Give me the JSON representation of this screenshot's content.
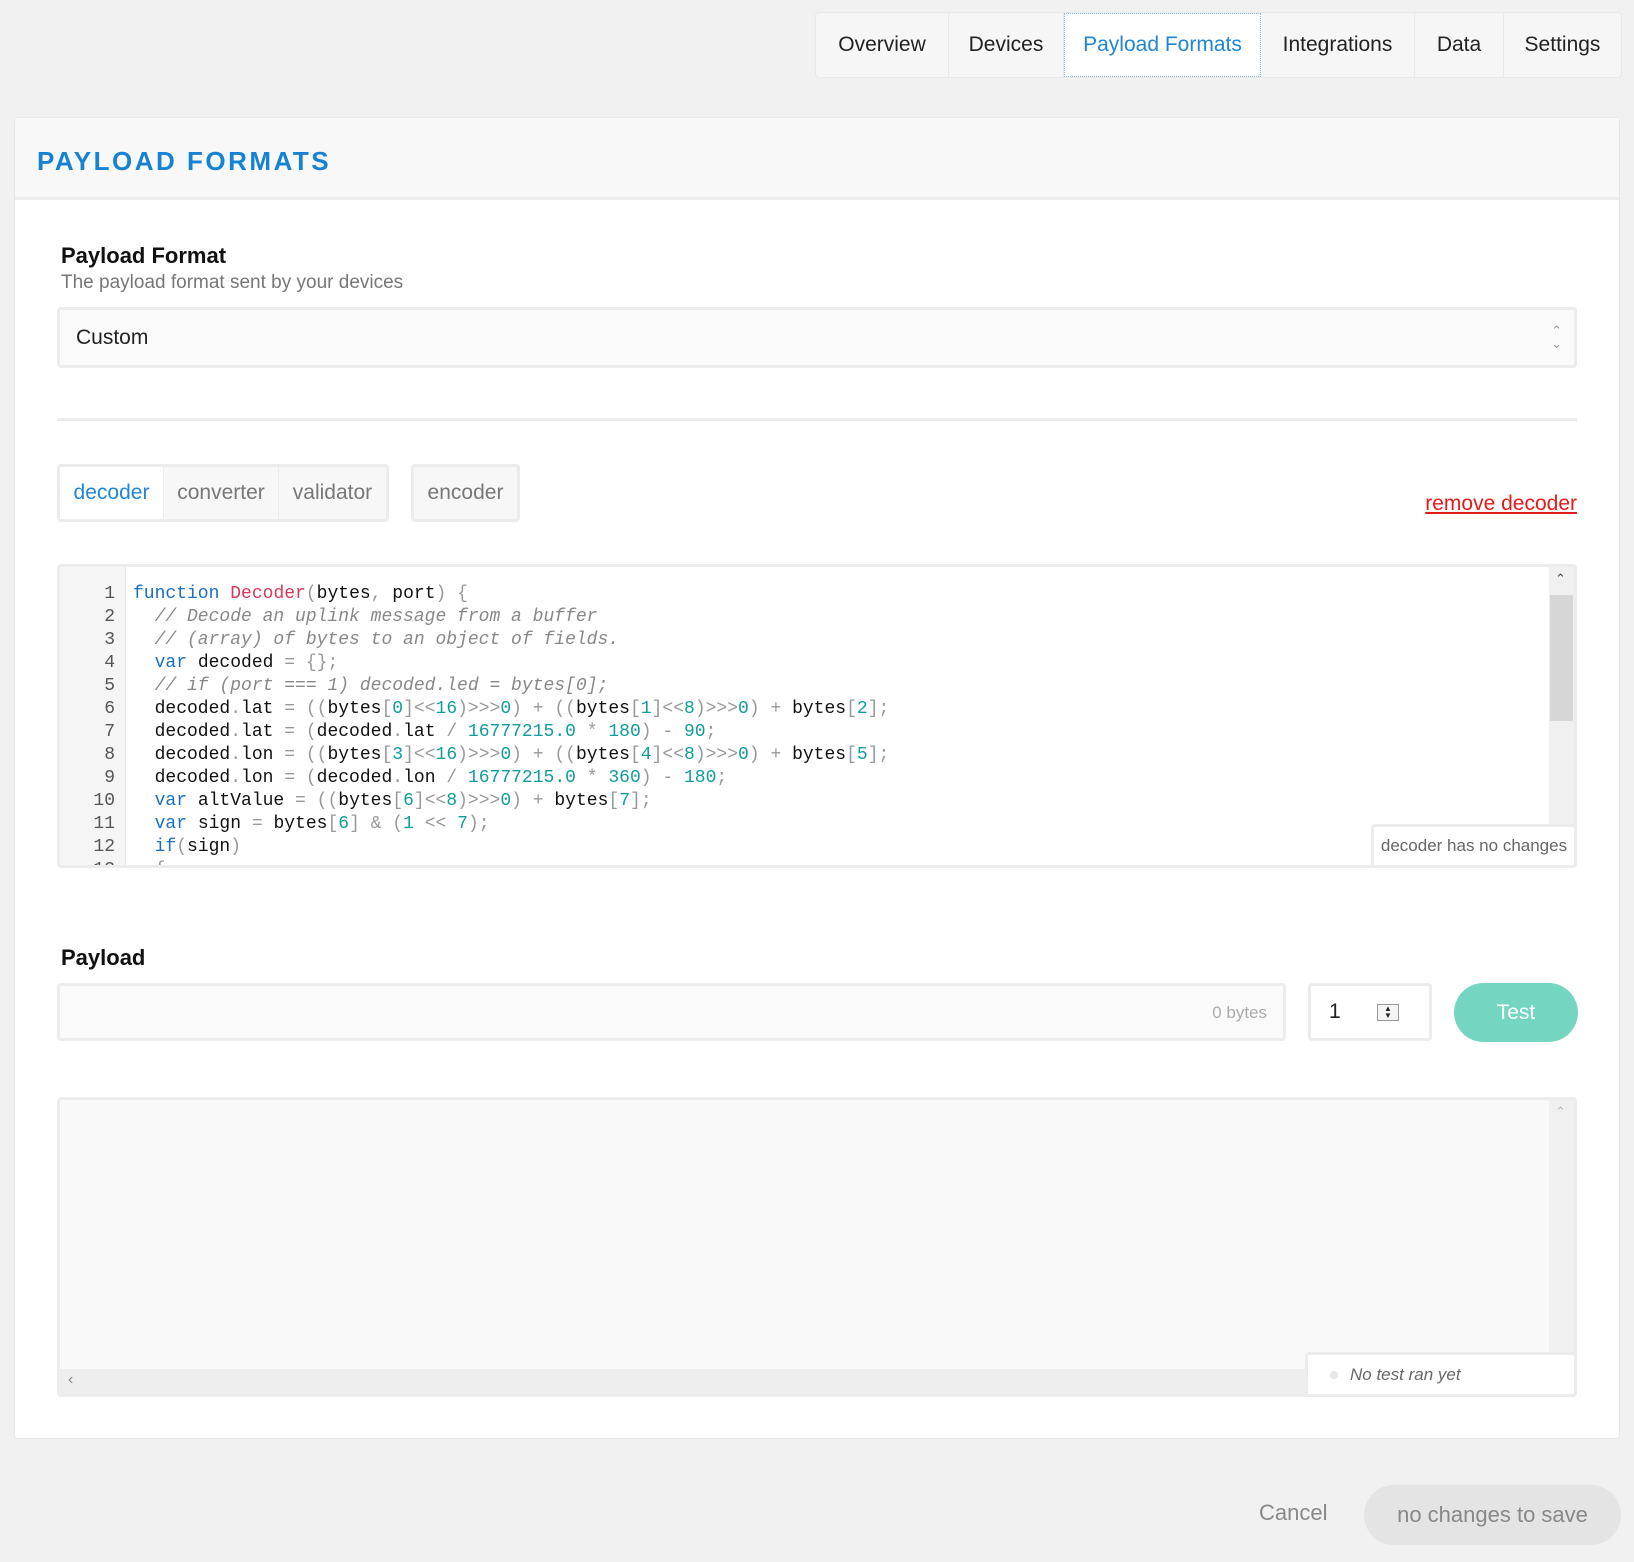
{
  "nav": {
    "tabs": [
      {
        "label": "Overview",
        "active": false
      },
      {
        "label": "Devices",
        "active": false
      },
      {
        "label": "Payload Formats",
        "active": true
      },
      {
        "label": "Integrations",
        "active": false
      },
      {
        "label": "Data",
        "active": false
      },
      {
        "label": "Settings",
        "active": false
      }
    ]
  },
  "panel": {
    "title": "PAYLOAD FORMATS"
  },
  "format": {
    "label": "Payload Format",
    "description": "The payload format sent by your devices",
    "selected": "Custom"
  },
  "function_tabs": [
    {
      "label": "decoder",
      "active": true
    },
    {
      "label": "converter",
      "active": false
    },
    {
      "label": "validator",
      "active": false
    }
  ],
  "encoder_tab": {
    "label": "encoder"
  },
  "remove_link": "remove decoder",
  "editor": {
    "status": "decoder has no changes",
    "lines": [
      [
        [
          "kw",
          "function"
        ],
        [
          "v",
          " "
        ],
        [
          "fn",
          "Decoder"
        ],
        [
          "p",
          "("
        ],
        [
          "v",
          "bytes"
        ],
        [
          "p",
          ", "
        ],
        [
          "v",
          "port"
        ],
        [
          "p",
          ") {"
        ]
      ],
      [
        [
          "c",
          "  // Decode an uplink message from a buffer"
        ]
      ],
      [
        [
          "c",
          "  // (array) of bytes to an object of fields."
        ]
      ],
      [
        [
          "v",
          "  "
        ],
        [
          "kw",
          "var"
        ],
        [
          "v",
          " decoded "
        ],
        [
          "p",
          "= {};"
        ]
      ],
      [
        [
          "c",
          "  // if (port === 1) decoded.led = bytes[0];"
        ]
      ],
      [
        [
          "v",
          "  decoded"
        ],
        [
          "p",
          "."
        ],
        [
          "v",
          "lat "
        ],
        [
          "p",
          "= (("
        ],
        [
          "v",
          "bytes"
        ],
        [
          "p",
          "["
        ],
        [
          "n",
          "0"
        ],
        [
          "p",
          "]<<"
        ],
        [
          "n",
          "16"
        ],
        [
          "p",
          ")>>>"
        ],
        [
          "n",
          "0"
        ],
        [
          "p",
          ") + (("
        ],
        [
          "v",
          "bytes"
        ],
        [
          "p",
          "["
        ],
        [
          "n",
          "1"
        ],
        [
          "p",
          "]<<"
        ],
        [
          "n",
          "8"
        ],
        [
          "p",
          ")>>>"
        ],
        [
          "n",
          "0"
        ],
        [
          "p",
          ") + "
        ],
        [
          "v",
          "bytes"
        ],
        [
          "p",
          "["
        ],
        [
          "n",
          "2"
        ],
        [
          "p",
          "];"
        ]
      ],
      [
        [
          "v",
          "  decoded"
        ],
        [
          "p",
          "."
        ],
        [
          "v",
          "lat "
        ],
        [
          "p",
          "= ("
        ],
        [
          "v",
          "decoded"
        ],
        [
          "p",
          "."
        ],
        [
          "v",
          "lat "
        ],
        [
          "p",
          "/ "
        ],
        [
          "n",
          "16777215.0"
        ],
        [
          "p",
          " * "
        ],
        [
          "n",
          "180"
        ],
        [
          "p",
          ") - "
        ],
        [
          "n",
          "90"
        ],
        [
          "p",
          ";"
        ]
      ],
      [
        [
          "v",
          "  decoded"
        ],
        [
          "p",
          "."
        ],
        [
          "v",
          "lon "
        ],
        [
          "p",
          "= (("
        ],
        [
          "v",
          "bytes"
        ],
        [
          "p",
          "["
        ],
        [
          "n",
          "3"
        ],
        [
          "p",
          "]<<"
        ],
        [
          "n",
          "16"
        ],
        [
          "p",
          ")>>>"
        ],
        [
          "n",
          "0"
        ],
        [
          "p",
          ") + (("
        ],
        [
          "v",
          "bytes"
        ],
        [
          "p",
          "["
        ],
        [
          "n",
          "4"
        ],
        [
          "p",
          "]<<"
        ],
        [
          "n",
          "8"
        ],
        [
          "p",
          ")>>>"
        ],
        [
          "n",
          "0"
        ],
        [
          "p",
          ") + "
        ],
        [
          "v",
          "bytes"
        ],
        [
          "p",
          "["
        ],
        [
          "n",
          "5"
        ],
        [
          "p",
          "];"
        ]
      ],
      [
        [
          "v",
          "  decoded"
        ],
        [
          "p",
          "."
        ],
        [
          "v",
          "lon "
        ],
        [
          "p",
          "= ("
        ],
        [
          "v",
          "decoded"
        ],
        [
          "p",
          "."
        ],
        [
          "v",
          "lon "
        ],
        [
          "p",
          "/ "
        ],
        [
          "n",
          "16777215.0"
        ],
        [
          "p",
          " * "
        ],
        [
          "n",
          "360"
        ],
        [
          "p",
          ") - "
        ],
        [
          "n",
          "180"
        ],
        [
          "p",
          ";"
        ]
      ],
      [
        [
          "v",
          "  "
        ],
        [
          "kw",
          "var"
        ],
        [
          "v",
          " altValue "
        ],
        [
          "p",
          "= (("
        ],
        [
          "v",
          "bytes"
        ],
        [
          "p",
          "["
        ],
        [
          "n",
          "6"
        ],
        [
          "p",
          "]<<"
        ],
        [
          "n",
          "8"
        ],
        [
          "p",
          ")>>>"
        ],
        [
          "n",
          "0"
        ],
        [
          "p",
          ") + "
        ],
        [
          "v",
          "bytes"
        ],
        [
          "p",
          "["
        ],
        [
          "n",
          "7"
        ],
        [
          "p",
          "];"
        ]
      ],
      [
        [
          "v",
          "  "
        ],
        [
          "kw",
          "var"
        ],
        [
          "v",
          " sign "
        ],
        [
          "p",
          "= "
        ],
        [
          "v",
          "bytes"
        ],
        [
          "p",
          "["
        ],
        [
          "n",
          "6"
        ],
        [
          "p",
          "] & ("
        ],
        [
          "n",
          "1"
        ],
        [
          "p",
          " << "
        ],
        [
          "n",
          "7"
        ],
        [
          "p",
          ");"
        ]
      ],
      [
        [
          "v",
          "  "
        ],
        [
          "kw",
          "if"
        ],
        [
          "p",
          "("
        ],
        [
          "v",
          "sign"
        ],
        [
          "p",
          ")"
        ]
      ],
      [
        [
          "p",
          "  {"
        ]
      ]
    ]
  },
  "payload": {
    "label": "Payload",
    "value": "",
    "byte_count": "0 bytes",
    "port": "1",
    "test_label": "Test"
  },
  "output": {
    "status": "No test ran yet"
  },
  "footer": {
    "cancel": "Cancel",
    "save": "no changes to save"
  },
  "colors": {
    "accent": "#1f86d6",
    "danger": "#e41b1b",
    "test": "#74d6c0"
  }
}
